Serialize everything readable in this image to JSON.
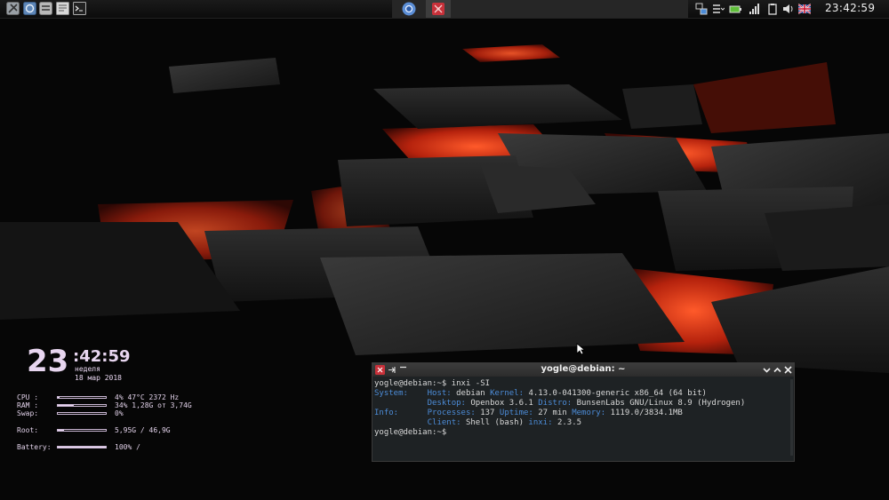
{
  "panel": {
    "launchers": [
      {
        "icon": "tools-icon"
      },
      {
        "icon": "browser-icon"
      },
      {
        "icon": "file-manager-icon"
      },
      {
        "icon": "text-editor-icon"
      },
      {
        "icon": "terminal-icon"
      }
    ],
    "tasks": [
      {
        "icon": "chromium-icon",
        "active": false
      },
      {
        "icon": "terminal-app-icon",
        "active": true
      }
    ],
    "tray": [
      "network-icon",
      "menu-icon",
      "battery-icon",
      "signal-icon",
      "clipboard-icon",
      "volume-icon",
      "uk-flag-icon"
    ],
    "clock": "23:42:59"
  },
  "conky": {
    "hours": "23",
    "minsec": ":42:59",
    "weekday": "неделя",
    "date": "18 мар 2018",
    "rows": [
      {
        "label": "CPU :",
        "value": "4%  47°C 2372 Hz",
        "fill": 0.04
      },
      {
        "label": "RAM :",
        "value": "34% 1,28G от 3,74G",
        "fill": 0.34
      },
      {
        "label": "Swap:",
        "value": "0%",
        "fill": 0
      },
      {
        "label": "Root:",
        "value": "5,95G / 46,9G",
        "fill": 0.13
      },
      {
        "label": "Battery:",
        "value": "100% /",
        "fill": 1.0
      }
    ]
  },
  "terminal": {
    "title": "yogle@debian: ~",
    "lines": {
      "cmd": "yogle@debian:~$ inxi -SI",
      "sys_label": "System:",
      "host_key": "Host:",
      "host_val": "debian",
      "kernel_key": "Kernel:",
      "kernel_val": "4.13.0-041300-generic x86_64 (64 bit)",
      "desktop_key": "Desktop:",
      "desktop_val": "Openbox 3.6.1",
      "distro_key": "Distro:",
      "distro_val": "BunsenLabs GNU/Linux 8.9 (Hydrogen)",
      "info_label": "Info:",
      "proc_key": "Processes:",
      "proc_val": "137",
      "uptime_key": "Uptime:",
      "uptime_val": "27 min",
      "mem_key": "Memory:",
      "mem_val": "1119.0/3834.1MB",
      "client_key": "Client:",
      "client_val": "Shell (bash)",
      "inxi_key": "inxi:",
      "inxi_val": "2.3.5",
      "prompt": "yogle@debian:~$"
    }
  },
  "colors": {
    "accent_blue": "#4c8cd8",
    "lava": "#d8361a",
    "conky_text": "#e8d6f0"
  }
}
